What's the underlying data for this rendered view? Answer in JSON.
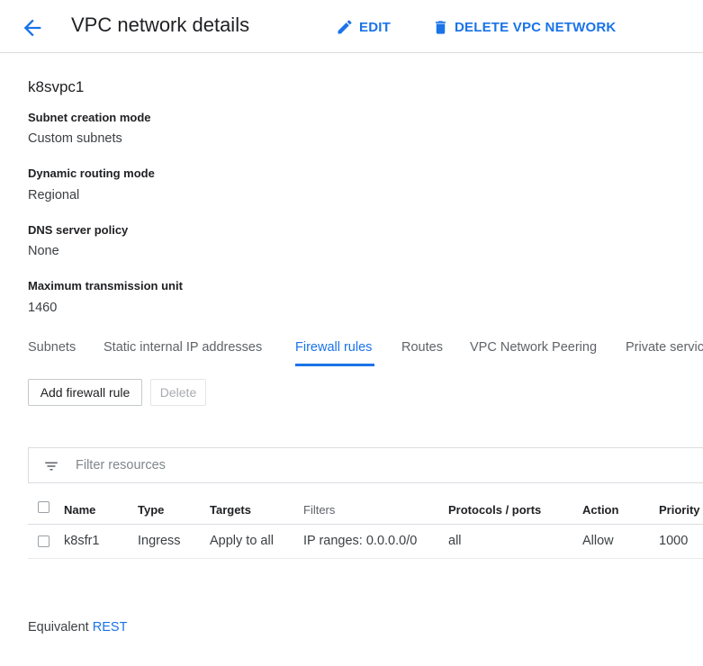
{
  "header": {
    "title": "VPC network details",
    "edit_label": "EDIT",
    "delete_label": "DELETE VPC NETWORK"
  },
  "network": {
    "name": "k8svpc1",
    "properties": [
      {
        "label": "Subnet creation mode",
        "value": "Custom subnets"
      },
      {
        "label": "Dynamic routing mode",
        "value": "Regional"
      },
      {
        "label": "DNS server policy",
        "value": "None"
      },
      {
        "label": "Maximum transmission unit",
        "value": "1460"
      }
    ]
  },
  "tabs": [
    {
      "label": "Subnets",
      "active": false
    },
    {
      "label": "Static internal IP addresses",
      "active": false
    },
    {
      "label": "Firewall rules",
      "active": true
    },
    {
      "label": "Routes",
      "active": false
    },
    {
      "label": "VPC Network Peering",
      "active": false
    },
    {
      "label": "Private service",
      "active": false
    }
  ],
  "toolbar": {
    "add_label": "Add firewall rule",
    "delete_label": "Delete"
  },
  "filter": {
    "placeholder": "Filter resources",
    "icon": "filter-list-icon"
  },
  "table": {
    "columns": [
      "Name",
      "Type",
      "Targets",
      "Filters",
      "Protocols / ports",
      "Action",
      "Priority"
    ],
    "rows": [
      {
        "name": "k8sfr1",
        "type": "Ingress",
        "targets": "Apply to all",
        "filters": "IP ranges: 0.0.0.0/0",
        "protocols": "all",
        "action": "Allow",
        "priority": "1000"
      }
    ]
  },
  "footer": {
    "prefix": "Equivalent",
    "link": "REST"
  },
  "colors": {
    "accent": "#1a73e8",
    "text": "#202124",
    "secondary_text": "#5f6368",
    "divider": "#dadce0"
  }
}
